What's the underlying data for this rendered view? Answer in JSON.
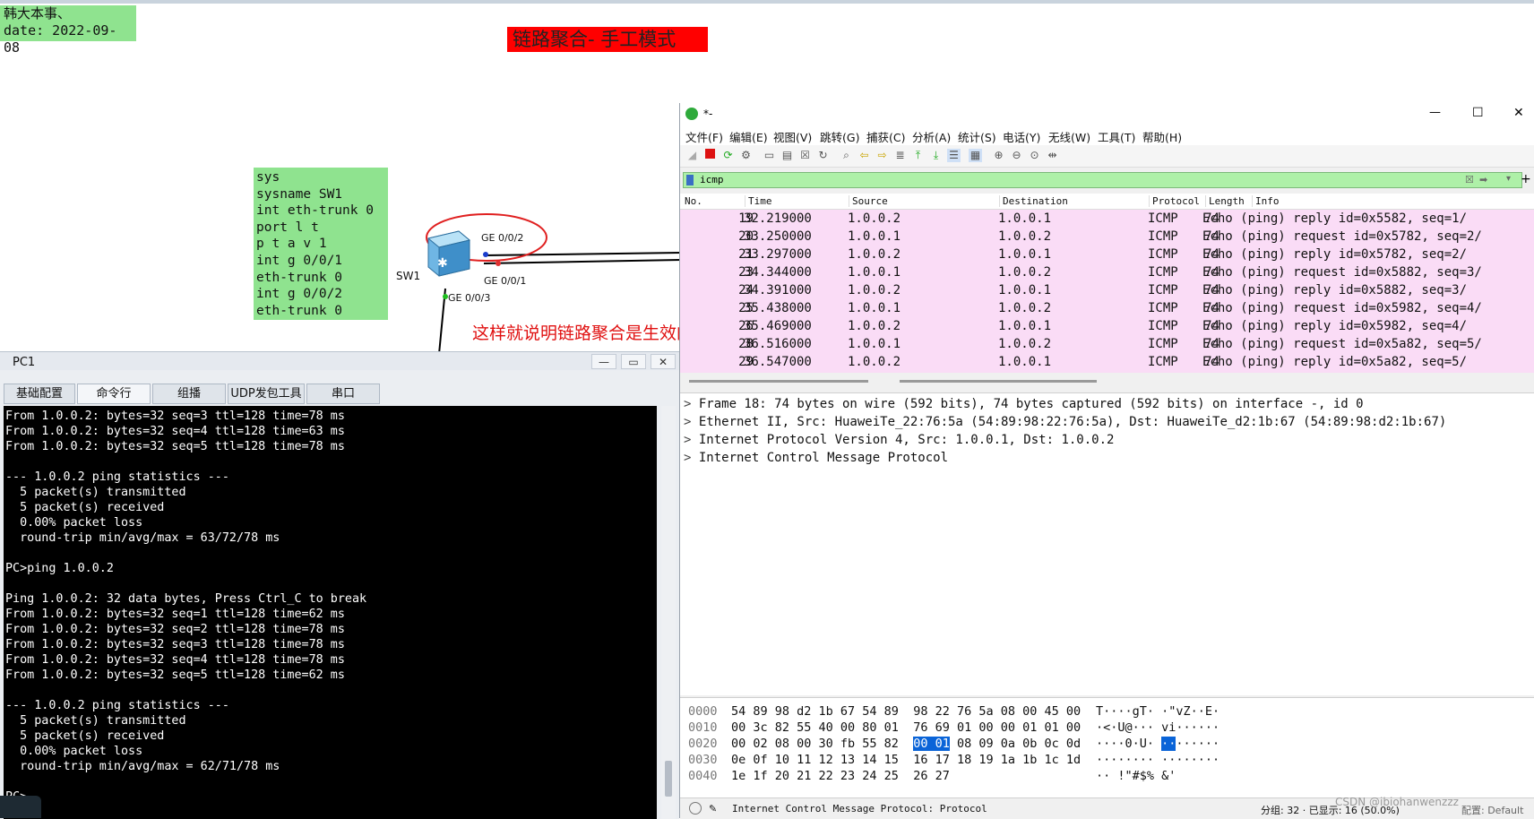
{
  "annotations": {
    "author_note_line1": "韩大本事、",
    "author_note_line2": "date: 2022-09-08",
    "title": "链路聚合- 手工模式",
    "conclusion": "这样就说明链路聚合是生效的",
    "config_commands": [
      "sys",
      "sysname SW1",
      "int eth-trunk 0",
      "port l t",
      "p t a v 1",
      "int g 0/0/1",
      "eth-trunk 0",
      "int g 0/0/2",
      "eth-trunk 0"
    ]
  },
  "topology": {
    "switch_label": "SW1",
    "port_labels": {
      "ge002": "GE 0/0/2",
      "ge001": "GE 0/0/1",
      "ge003": "GE 0/0/3"
    },
    "colors": {
      "link": "#000000",
      "highlight_circle": "#e02020",
      "port_up": "#1fbf1f",
      "port_blue": "#1a3ccc"
    }
  },
  "pc1": {
    "title": "PC1",
    "controls": {
      "minimize": "—",
      "maximize": "▭",
      "close": "✕"
    },
    "tabs": [
      "基础配置",
      "命令行",
      "组播",
      "UDP发包工具",
      "串口"
    ],
    "active_tab": "命令行",
    "console_lines": [
      "From 1.0.0.2: bytes=32 seq=3 ttl=128 time=78 ms",
      "From 1.0.0.2: bytes=32 seq=4 ttl=128 time=63 ms",
      "From 1.0.0.2: bytes=32 seq=5 ttl=128 time=78 ms",
      "",
      "--- 1.0.0.2 ping statistics ---",
      "  5 packet(s) transmitted",
      "  5 packet(s) received",
      "  0.00% packet loss",
      "  round-trip min/avg/max = 63/72/78 ms",
      "",
      "PC>ping 1.0.0.2",
      "",
      "Ping 1.0.0.2: 32 data bytes, Press Ctrl_C to break",
      "From 1.0.0.2: bytes=32 seq=1 ttl=128 time=62 ms",
      "From 1.0.0.2: bytes=32 seq=2 ttl=128 time=78 ms",
      "From 1.0.0.2: bytes=32 seq=3 ttl=128 time=78 ms",
      "From 1.0.0.2: bytes=32 seq=4 ttl=128 time=78 ms",
      "From 1.0.0.2: bytes=32 seq=5 ttl=128 time=62 ms",
      "",
      "--- 1.0.0.2 ping statistics ---",
      "  5 packet(s) transmitted",
      "  5 packet(s) received",
      "  0.00% packet loss",
      "  round-trip min/avg/max = 62/71/78 ms",
      "",
      "PC>"
    ]
  },
  "wireshark": {
    "title": "*-",
    "controls": {
      "minimize": "—",
      "maximize": "☐",
      "close": "✕"
    },
    "menu": [
      "文件(F)",
      "编辑(E)",
      "视图(V)",
      "跳转(G)",
      "捕获(C)",
      "分析(A)",
      "统计(S)",
      "电话(Y)",
      "无线(W)",
      "工具(T)",
      "帮助(H)"
    ],
    "filter_text": "icmp",
    "filter_color": "#aef0a8",
    "columns": [
      "No.",
      "Time",
      "Source",
      "Destination",
      "Protocol",
      "Length",
      "Info"
    ],
    "packets": [
      {
        "no": "19",
        "time": "32.219000",
        "src": "1.0.0.2",
        "dst": "1.0.0.1",
        "proto": "ICMP",
        "len": "74",
        "info": "Echo (ping) reply    id=0x5582, seq=1/"
      },
      {
        "no": "20",
        "time": "33.250000",
        "src": "1.0.0.1",
        "dst": "1.0.0.2",
        "proto": "ICMP",
        "len": "74",
        "info": "Echo (ping) request  id=0x5782, seq=2/"
      },
      {
        "no": "21",
        "time": "33.297000",
        "src": "1.0.0.2",
        "dst": "1.0.0.1",
        "proto": "ICMP",
        "len": "74",
        "info": "Echo (ping) reply    id=0x5782, seq=2/"
      },
      {
        "no": "23",
        "time": "34.344000",
        "src": "1.0.0.1",
        "dst": "1.0.0.2",
        "proto": "ICMP",
        "len": "74",
        "info": "Echo (ping) request  id=0x5882, seq=3/"
      },
      {
        "no": "24",
        "time": "34.391000",
        "src": "1.0.0.2",
        "dst": "1.0.0.1",
        "proto": "ICMP",
        "len": "74",
        "info": "Echo (ping) reply    id=0x5882, seq=3/"
      },
      {
        "no": "25",
        "time": "35.438000",
        "src": "1.0.0.1",
        "dst": "1.0.0.2",
        "proto": "ICMP",
        "len": "74",
        "info": "Echo (ping) request  id=0x5982, seq=4/"
      },
      {
        "no": "26",
        "time": "35.469000",
        "src": "1.0.0.2",
        "dst": "1.0.0.1",
        "proto": "ICMP",
        "len": "74",
        "info": "Echo (ping) reply    id=0x5982, seq=4/"
      },
      {
        "no": "28",
        "time": "36.516000",
        "src": "1.0.0.1",
        "dst": "1.0.0.2",
        "proto": "ICMP",
        "len": "74",
        "info": "Echo (ping) request  id=0x5a82, seq=5/"
      },
      {
        "no": "29",
        "time": "36.547000",
        "src": "1.0.0.2",
        "dst": "1.0.0.1",
        "proto": "ICMP",
        "len": "74",
        "info": "Echo (ping) reply    id=0x5a82, seq=5/"
      }
    ],
    "row_color": "#fadcf6",
    "details": [
      "Frame 18: 74 bytes on wire (592 bits), 74 bytes captured (592 bits) on interface -, id 0",
      "Ethernet II, Src: HuaweiTe_22:76:5a (54:89:98:22:76:5a), Dst: HuaweiTe_d2:1b:67 (54:89:98:d2:1b:67)",
      "Internet Protocol Version 4, Src: 1.0.0.1, Dst: 1.0.0.2",
      "Internet Control Message Protocol"
    ],
    "hex_rows": [
      {
        "off": "0000",
        "a": "54 89 98 d2 1b 67 54 89  98 22 76 5a 08 00 45 00",
        "asc": "T····gT· ·\"vZ··E·"
      },
      {
        "off": "0010",
        "a": "00 3c 82 55 40 00 80 01  76 69 01 00 00 01 01 00",
        "asc": "·<·U@··· vi······"
      },
      {
        "off": "0020",
        "a1": "00 02 08 00 30 fb 55 82  ",
        "sel": "00 01",
        "a2": " 08 09 0a 0b 0c 0d",
        "asc1": "····0·U· ",
        "asc_sel": "··",
        "asc2": "······"
      },
      {
        "off": "0030",
        "a": "0e 0f 10 11 12 13 14 15  16 17 18 19 1a 1b 1c 1d",
        "asc": "········ ········"
      },
      {
        "off": "0040",
        "a": "1e 1f 20 21 22 23 24 25  26 27",
        "asc": "·· !\"#$% &'"
      }
    ],
    "status_text": "Internet Control Message Protocol: Protocol",
    "status_right": "分组: 32 · 已显示: 16 (50.0%)",
    "status_profile": "配置: Default",
    "watermark": "CSDN @ibiohanwenzzz"
  }
}
